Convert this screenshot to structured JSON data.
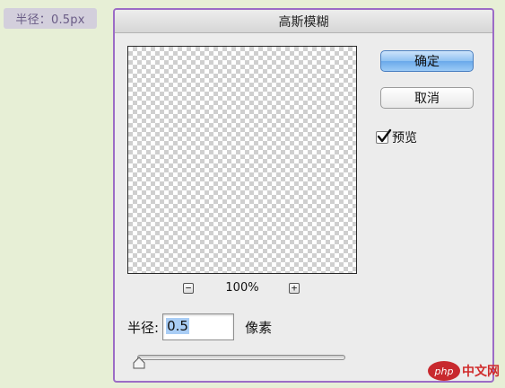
{
  "caption": {
    "text": "半径：0.5px"
  },
  "dialog": {
    "title": "高斯模糊",
    "ok_label": "确定",
    "cancel_label": "取消",
    "preview_label": "预览",
    "preview_checked": true,
    "zoom_out_symbol": "−",
    "zoom_in_symbol": "+",
    "zoom_level": "100%",
    "radius_label": "半径:",
    "radius_value": "0.5",
    "radius_unit": "像素",
    "slider_value": 0.5
  },
  "watermark": {
    "logo": "php",
    "text": "中文网"
  },
  "colors": {
    "page_bg": "#e7efd6",
    "dialog_border": "#9c6cc6",
    "ok_button": "#8fc1f2",
    "watermark_red": "#c8292e"
  }
}
